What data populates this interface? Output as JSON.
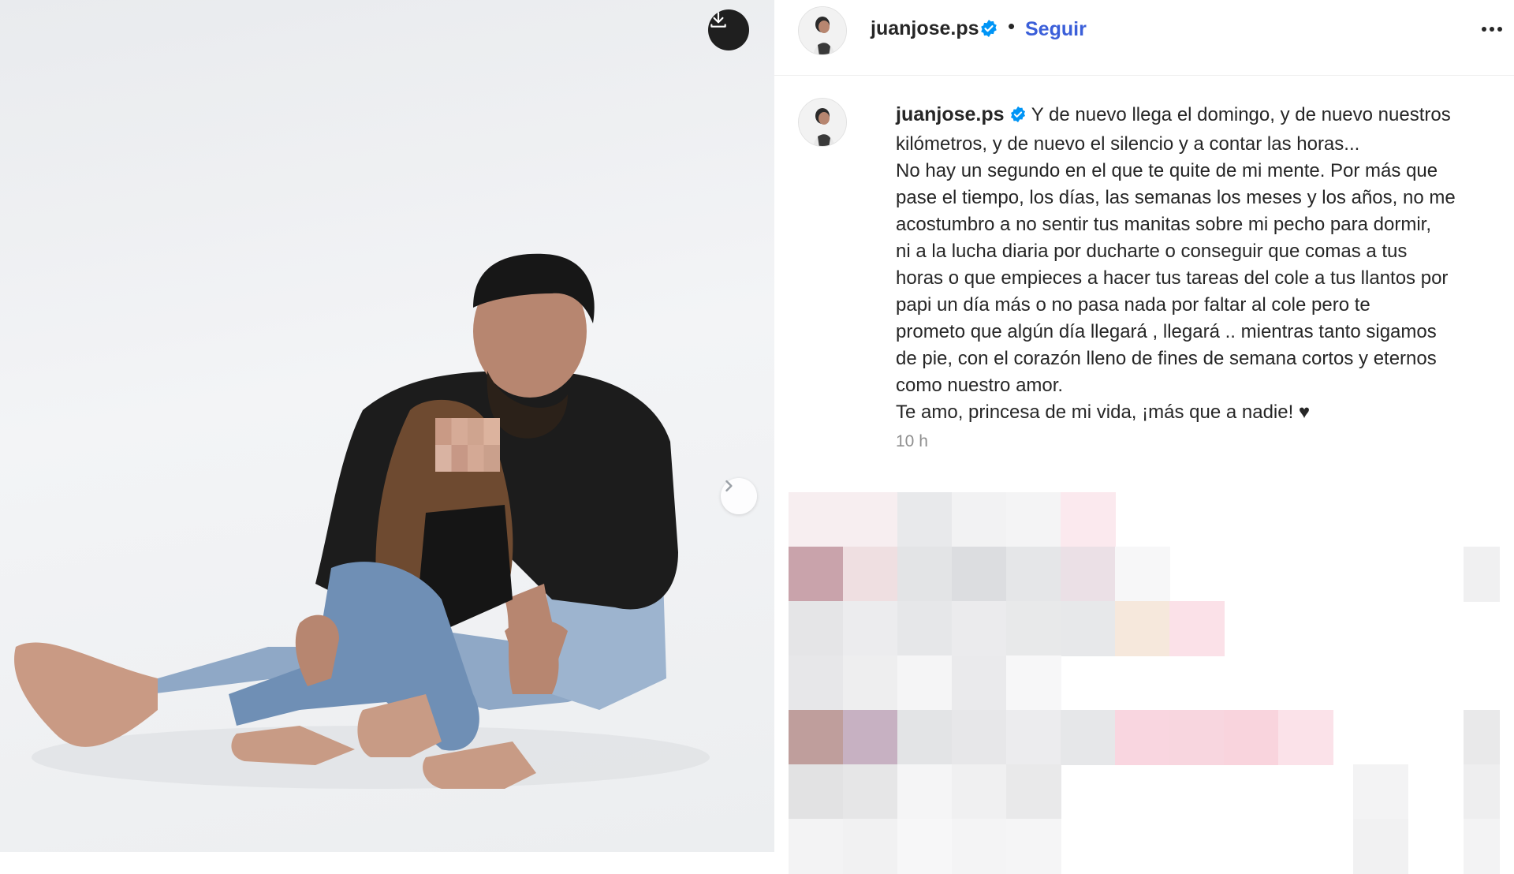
{
  "post": {
    "author": {
      "username": "juanjose.ps",
      "verified": true,
      "follow_label": "Seguir"
    },
    "caption": {
      "username": "juanjose.ps",
      "lines": [
        "Y de nuevo llega el domingo, y de nuevo nuestros",
        "kilómetros, y de nuevo el silencio y a contar las horas...",
        "No hay un segundo en el que te quite de mi mente. Por más que",
        "pase el tiempo, los días, las semanas los meses y los años, no me",
        "acostumbro a no sentir tus manitas sobre mi pecho para dormir,",
        "ni a la lucha diaria por ducharte o conseguir que comas a tus",
        "horas o que empieces a hacer tus tareas del cole a tus llantos por",
        "papi un día más o no pasa nada por faltar al cole pero te",
        "prometo que algún día llegará , llegará .. mientras tanto sigamos",
        "de pie, con el corazón lleno de fines de semana cortos y eternos",
        "como nuestro amor.",
        "Te amo, princesa de mi vida, ¡más que a nadie! ♥"
      ]
    },
    "timestamp": "10 h"
  },
  "icons": {
    "download": "download-icon",
    "next": "chevron-right-icon",
    "more": "more-options-icon",
    "verified": "verified-badge-icon"
  },
  "colors": {
    "verified_blue": "#0095f6",
    "follow_link": "#3b5fd9",
    "text": "#262626",
    "muted": "#8e8e8e"
  }
}
